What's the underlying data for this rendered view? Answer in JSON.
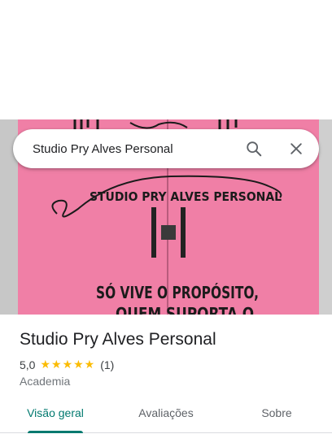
{
  "search": {
    "query": "Studio Pry Alves Personal"
  },
  "hero": {
    "door_sign_name": "STUDIO PRY ALVES PERSONAL",
    "door_text_line1": "SÓ VIVE O PROPÓSITO,",
    "door_text_line2": "QUEM SUPORTA O"
  },
  "place": {
    "title": "Studio Pry Alves Personal",
    "rating": "5,0",
    "stars": "★★★★★",
    "review_count": "(1)",
    "category": "Academia"
  },
  "tabs": [
    {
      "label": "Visão geral",
      "active": true
    },
    {
      "label": "Avaliações",
      "active": false
    },
    {
      "label": "Sobre",
      "active": false
    }
  ],
  "colors": {
    "accent": "#01796f",
    "star": "#fbbc04",
    "door_pink": "#f07fa6"
  },
  "icons": [
    "search-icon",
    "close-icon",
    "star-icon"
  ]
}
